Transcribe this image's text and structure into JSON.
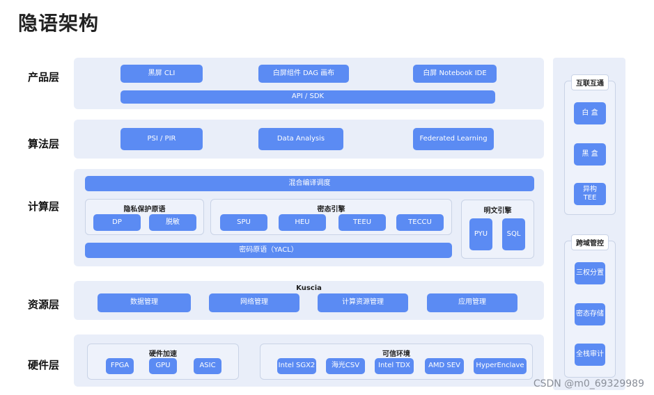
{
  "title": "隐语架构",
  "layers": {
    "product": {
      "label": "产品层",
      "items": [
        "黑屏 CLI",
        "白屏组件 DAG 画布",
        "白屏 Notebook IDE"
      ],
      "api": "API / SDK"
    },
    "algorithm": {
      "label": "算法层",
      "items": [
        "PSI / PIR",
        "Data Analysis",
        "Federated Learning"
      ]
    },
    "compute": {
      "label": "计算层",
      "scheduler": "混合编译调度",
      "privacy_primitives": {
        "title": "隐私保护原语",
        "items": [
          "DP",
          "脱敏"
        ]
      },
      "cipher_engine": {
        "title": "密态引擎",
        "items": [
          "SPU",
          "HEU",
          "TEEU",
          "TECCU"
        ]
      },
      "plain_engine": {
        "title": "明文引擎",
        "items": [
          "PYU",
          "SQL"
        ]
      },
      "crypto": "密码原语（YACL）"
    },
    "resource": {
      "label": "资源层",
      "title": "Kuscia",
      "items": [
        "数据管理",
        "网络管理",
        "计算资源管理",
        "应用管理"
      ]
    },
    "hardware": {
      "label": "硬件层",
      "acceleration": {
        "title": "硬件加速",
        "items": [
          "FPGA",
          "GPU",
          "ASIC"
        ]
      },
      "trusted_env": {
        "title": "可信环境",
        "items": [
          "Intel SGX2",
          "海光CSV",
          "Intel TDX",
          "AMD SEV",
          "HyperEnclave"
        ]
      }
    }
  },
  "side": {
    "interop": {
      "title": "互联互通",
      "items": [
        "白 盒",
        "黑 盒",
        "异构\nTEE"
      ]
    },
    "cross_domain": {
      "title": "跨域管控",
      "items": [
        "三权分置",
        "密态存储",
        "全栈审计"
      ]
    }
  },
  "watermark": "CSDN @m0_69329989",
  "colors": {
    "button": "#5b8bf3",
    "band": "#e9eef9",
    "border": "#c9d3e6"
  }
}
